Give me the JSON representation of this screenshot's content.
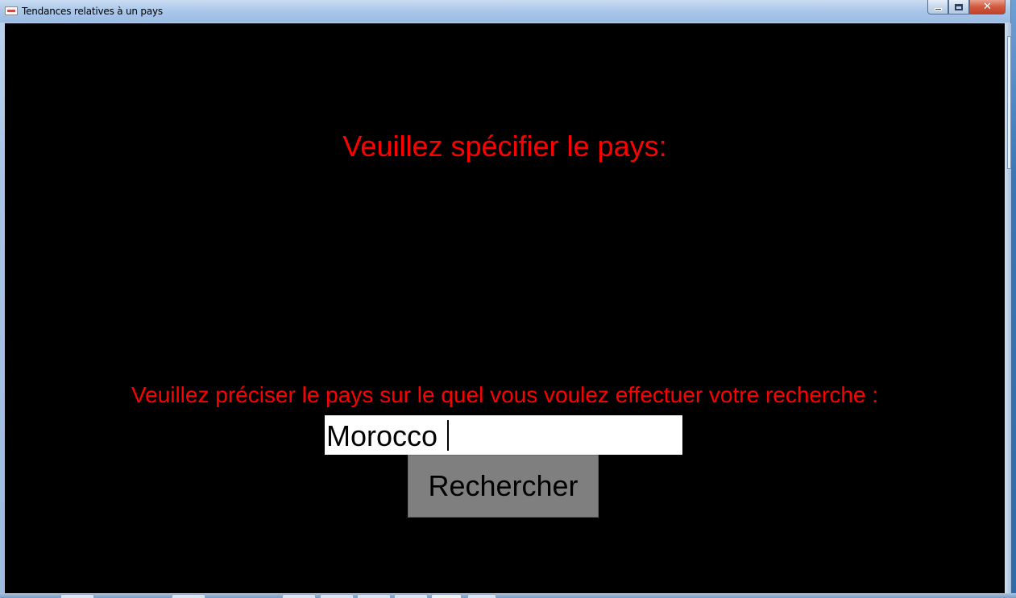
{
  "window": {
    "title": "Tendances relatives à un pays"
  },
  "main": {
    "heading": "Veuillez spécifier le pays:",
    "prompt": "Veuillez préciser le pays sur le quel vous voulez effectuer votre recherche :",
    "country_input": {
      "value": "Morocco",
      "placeholder": ""
    },
    "search_button": "Rechercher"
  },
  "colors": {
    "text_accent": "#ff0000",
    "background": "#000000",
    "button": "#7f7f7f"
  },
  "icons": {
    "app": "app-window-icon",
    "minimize": "minimize-icon",
    "maximize": "maximize-icon",
    "close": "close-icon"
  }
}
